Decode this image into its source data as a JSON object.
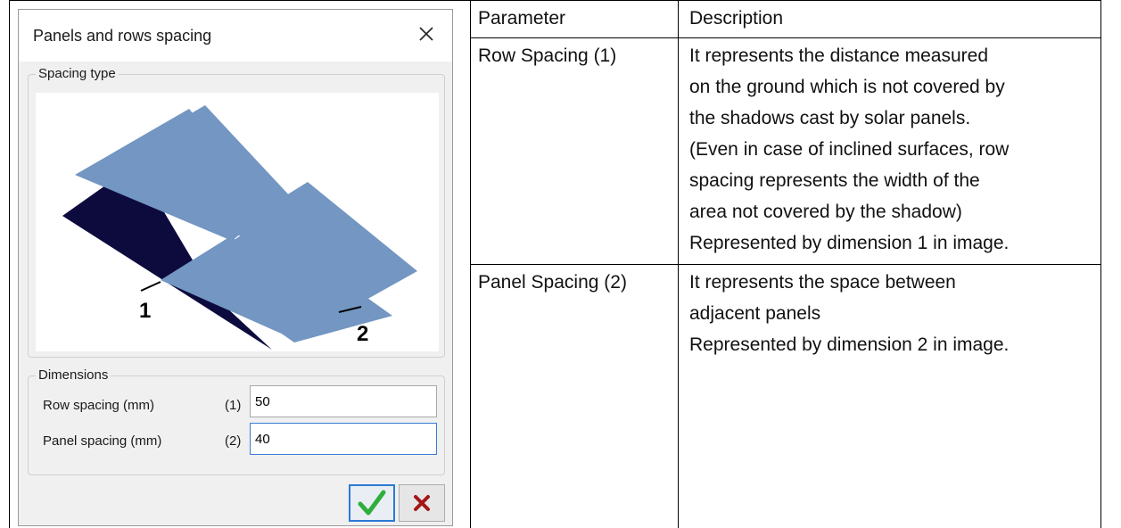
{
  "dialog": {
    "title": "Panels and rows spacing",
    "spacing_group_label": "Spacing type",
    "dimensions_group_label": "Dimensions",
    "diagram_labels": [
      "1",
      "2"
    ],
    "row_spacing": {
      "label": "Row spacing (mm)",
      "index": "(1)",
      "value": "50"
    },
    "panel_spacing": {
      "label": "Panel spacing (mm)",
      "index": "(2)",
      "value": "40"
    },
    "ok_icon": "check-icon",
    "cancel_icon": "x-icon",
    "colors": {
      "panel": "#7396c2",
      "shadow": "#0d0b3e",
      "ok": "#2fae3c",
      "cancel": "#a31616"
    }
  },
  "table": {
    "headers": [
      "Parameter",
      "Description"
    ],
    "rows": [
      {
        "parameter": "Row Spacing (1)",
        "description": [
          "It represents the distance measured",
          "on the ground which is not covered by",
          "the shadows cast by solar panels.",
          "(Even in case of inclined surfaces, row",
          "spacing represents the width of the",
          "area not covered by the shadow)",
          "Represented by dimension 1 in image."
        ]
      },
      {
        "parameter": "Panel Spacing (2)",
        "description": [
          "It represents the space between",
          "adjacent panels",
          "Represented by dimension 2 in image."
        ]
      }
    ]
  }
}
